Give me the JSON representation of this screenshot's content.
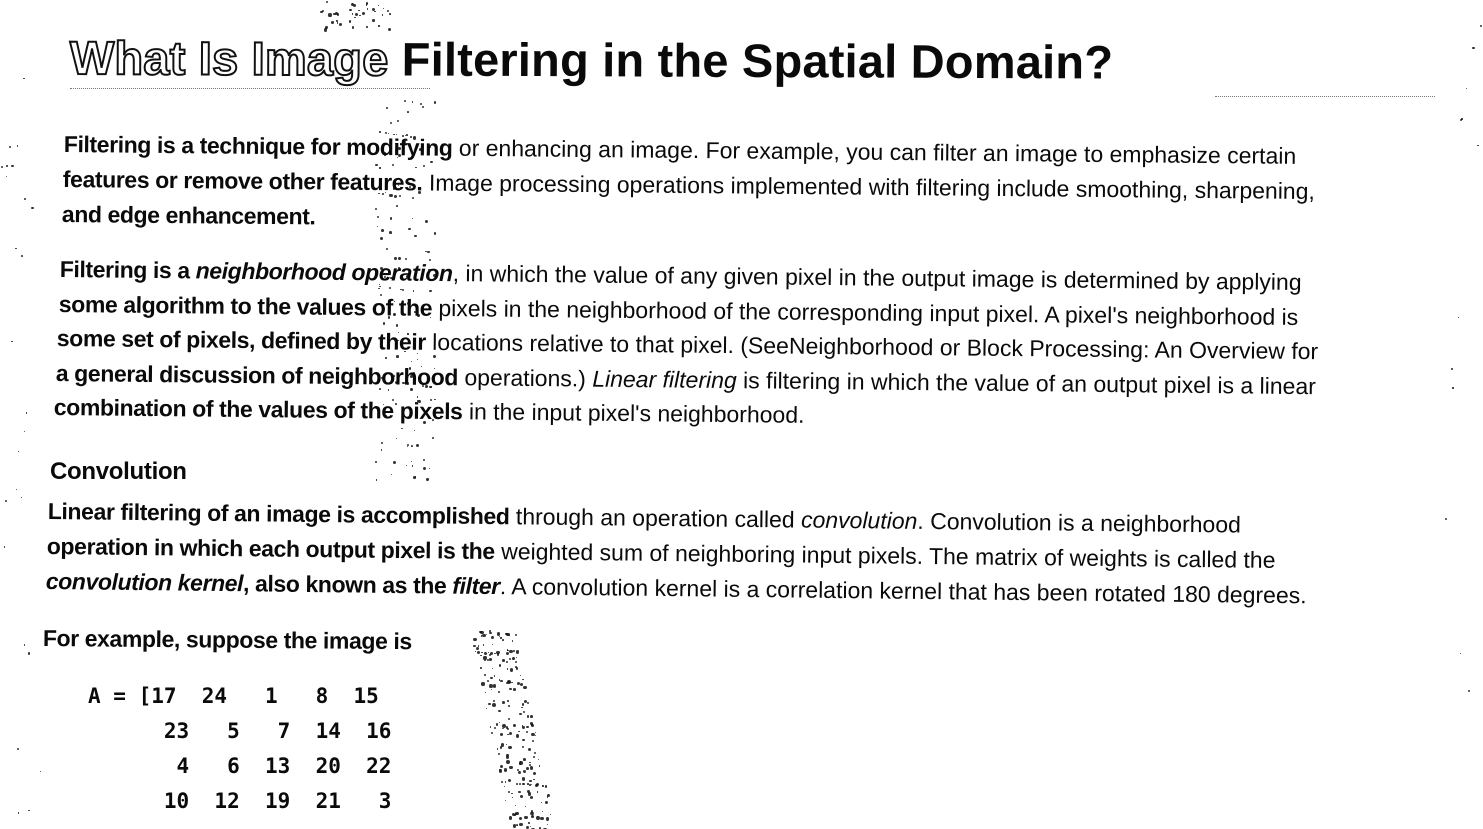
{
  "document": {
    "title_part1": "What Is Image ",
    "title_part2": "Filtering in the Spatial Domain?",
    "para1": {
      "l1_a": "Filtering is a technique for modifying",
      "l1_b": " or enhancing an image. For example, you can filter an image to emphasize certain",
      "l2_a": "features or remove other features.",
      "l2_b": " Image processing operations implemented with filtering include smoothing, sharpening,",
      "l3_a": "and edge enhancement."
    },
    "para2": {
      "l1_a": "Filtering is a ",
      "l1_i": "neighborhood operation",
      "l1_b": ", in which the value of any given pixel in the output image is determined by applying",
      "l2_a": "some algorithm to the values of the",
      "l2_b": " pixels in the neighborhood of the corresponding input pixel. A pixel's neighborhood is",
      "l3_a": "some set of pixels, defined by their",
      "l3_b": " locations relative to that pixel. (SeeNeighborhood or Block Processing: An Overview for",
      "l4_a": "a general discussion of neighborhood",
      "l4_b": " operations.) ",
      "l4_i": "Linear filtering",
      "l4_c": " is filtering in which the value of an output pixel is a linear",
      "l5_a": "combination of the values of the pixels",
      "l5_b": " in the input pixel's neighborhood."
    },
    "convolution_heading": "Convolution",
    "para3": {
      "l1_a": "Linear filtering of an image is accomplished",
      "l1_b": " through an operation called ",
      "l1_i": "convolution",
      "l1_c": ". Convolution is a neighborhood",
      "l2_a": "operation in which each output pixel is the",
      "l2_b": " weighted sum of neighboring input pixels. The matrix of weights is called the",
      "l3_i1": "convolution kernel",
      "l3_a": ", also known as the ",
      "l3_i2": "filter",
      "l3_b": ". A convolution kernel is a correlation kernel that has been rotated 180 degrees."
    },
    "example_intro": "For example, suppose the image is",
    "matrix": {
      "row1": "A = [17  24   1   8  15",
      "row2": "      23   5   7  14  16",
      "row3": "       4   6  13  20  22",
      "row4": "      10  12  19  21   3"
    }
  }
}
